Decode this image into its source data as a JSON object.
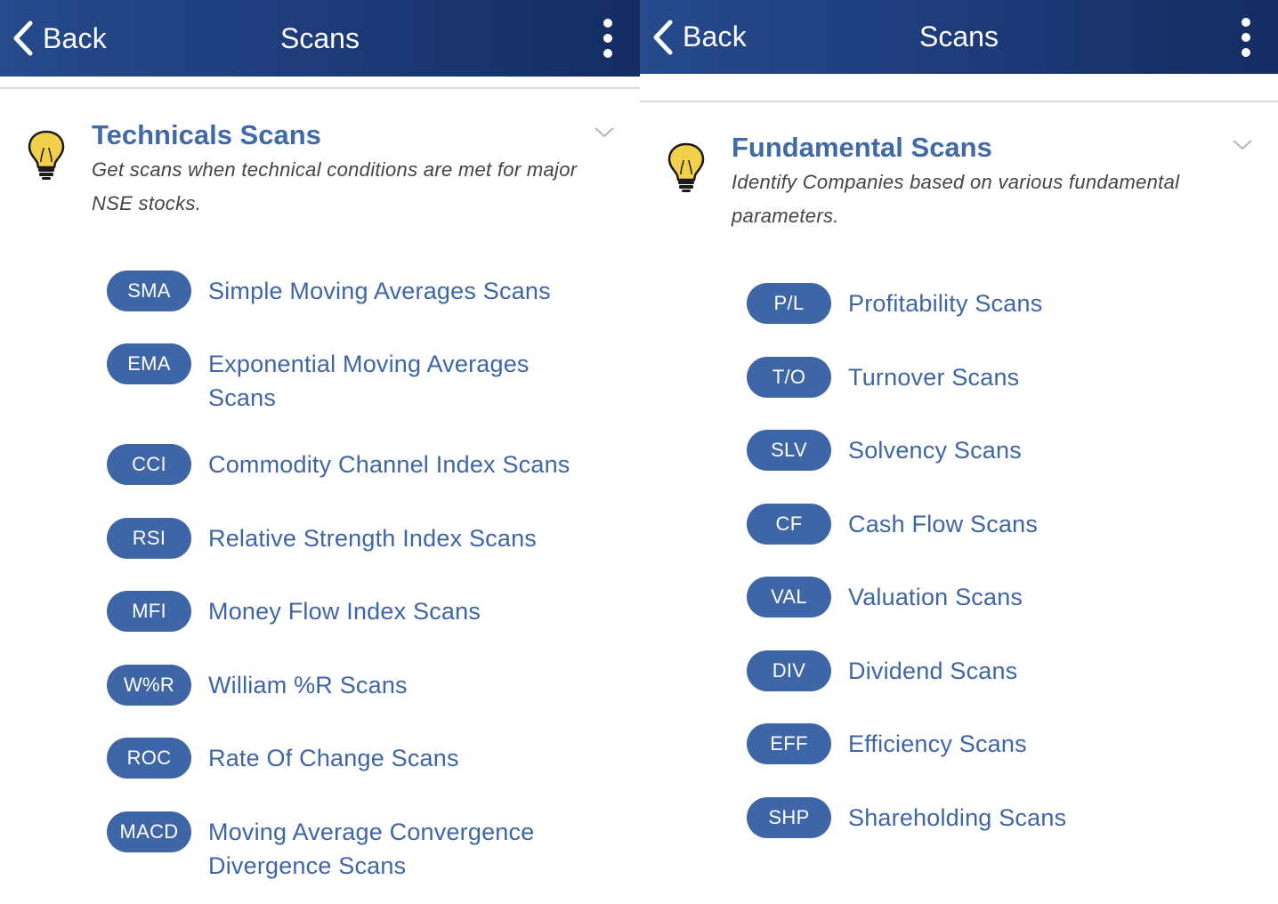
{
  "screens": [
    {
      "header": {
        "back_label": "Back",
        "title": "Scans"
      },
      "section": {
        "title": "Technicals Scans",
        "description": "Get scans when technical conditions are met for major NSE stocks."
      },
      "items": [
        {
          "badge": "SMA",
          "label": "Simple Moving Averages Scans"
        },
        {
          "badge": "EMA",
          "label": "Exponential Moving Averages Scans"
        },
        {
          "badge": "CCI",
          "label": "Commodity Channel Index Scans"
        },
        {
          "badge": "RSI",
          "label": "Relative Strength Index Scans"
        },
        {
          "badge": "MFI",
          "label": "Money Flow Index Scans"
        },
        {
          "badge": "W%R",
          "label": "William %R Scans"
        },
        {
          "badge": "ROC",
          "label": "Rate Of Change Scans"
        },
        {
          "badge": "MACD",
          "label": "Moving Average Convergence Divergence Scans"
        }
      ]
    },
    {
      "header": {
        "back_label": "Back",
        "title": "Scans"
      },
      "section": {
        "title": "Fundamental Scans",
        "description": "Identify Companies based on various fundamental parameters."
      },
      "items": [
        {
          "badge": "P/L",
          "label": "Profitability Scans"
        },
        {
          "badge": "T/O",
          "label": "Turnover Scans"
        },
        {
          "badge": "SLV",
          "label": "Solvency Scans"
        },
        {
          "badge": "CF",
          "label": "Cash Flow Scans"
        },
        {
          "badge": "VAL",
          "label": "Valuation Scans"
        },
        {
          "badge": "DIV",
          "label": "Dividend Scans"
        },
        {
          "badge": "EFF",
          "label": "Efficiency Scans"
        },
        {
          "badge": "SHP",
          "label": "Shareholding Scans"
        }
      ]
    }
  ],
  "icons": {
    "back": "chevron-left-icon",
    "menu": "more-vertical-icon",
    "section": "lightbulb-icon",
    "collapse": "chevron-down-icon"
  },
  "colors": {
    "header_bar": "#1f3c7a",
    "accent": "#3e65a5",
    "title": "#3f6aa6",
    "bulb": "#f2d04b"
  }
}
